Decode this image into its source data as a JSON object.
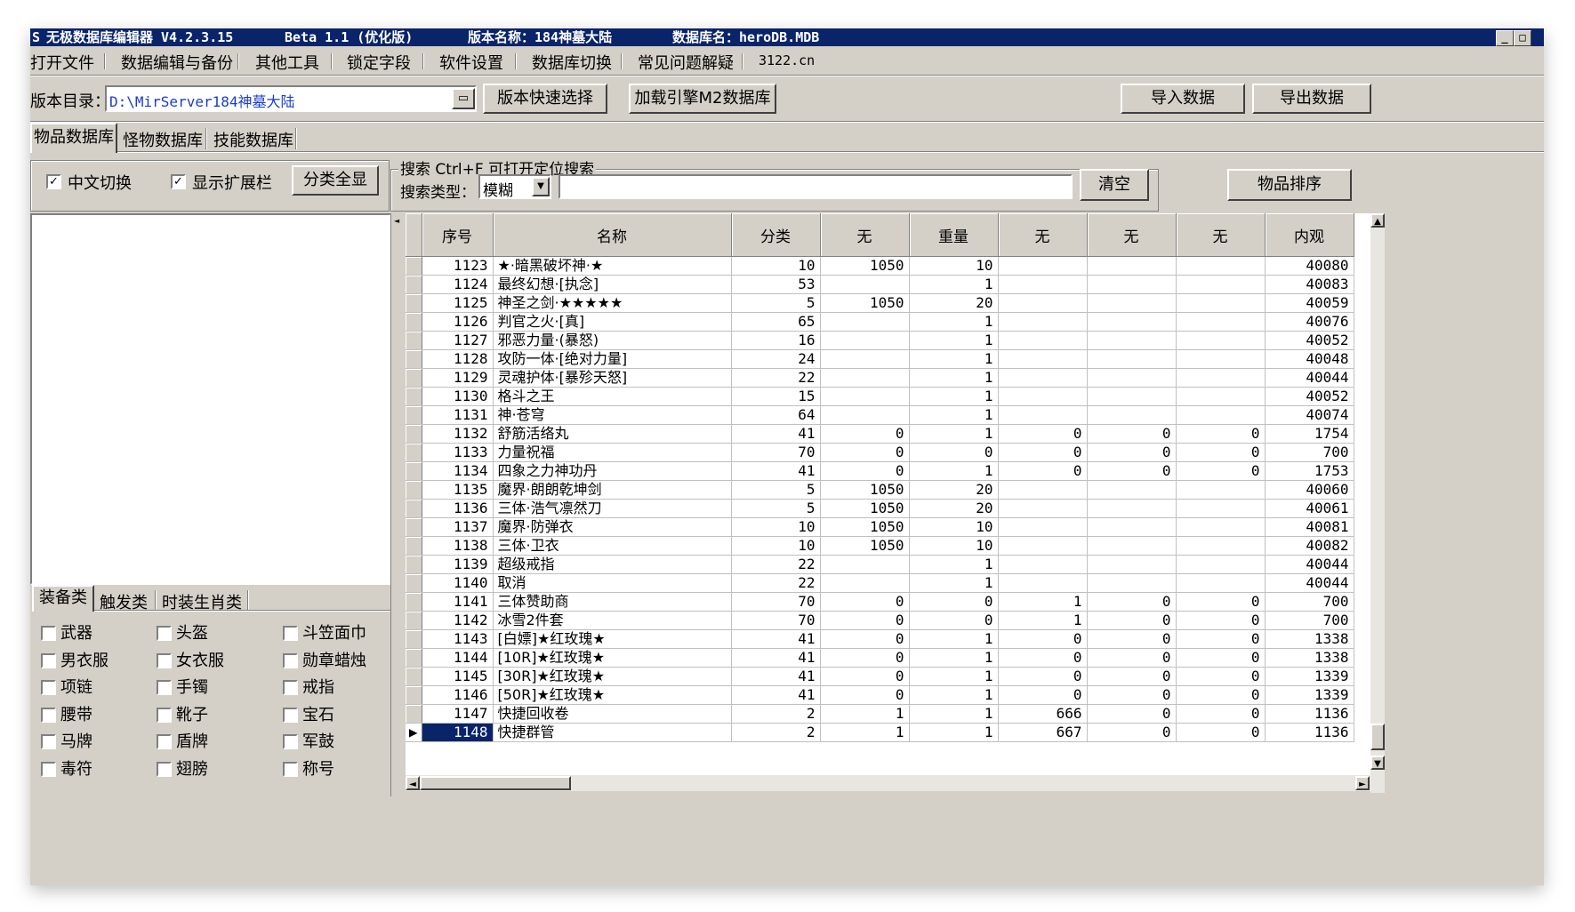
{
  "titlebar": {
    "app_name": "无极数据库编辑器 V4.2.3.15",
    "beta": "Beta 1.1 (优化版)",
    "version_name": "版本名称：184神墓大陆",
    "db_name": "数据库名：heroDB.MDB"
  },
  "menu": [
    "打开文件",
    "数据编辑与备份",
    "其他工具",
    "锁定字段",
    "软件设置",
    "数据库切换",
    "常见问题解疑",
    "3122.cn"
  ],
  "toolbar": {
    "dir_label": "版本目录：",
    "dir_value": "D:\\MirServer184神墓大陆",
    "quick_select": "版本快速选择",
    "load_m2": "加载引擎M2数据库",
    "import": "导入数据",
    "export": "导出数据"
  },
  "tabs": [
    "物品数据库",
    "怪物数据库",
    "技能数据库"
  ],
  "options": {
    "chinese_switch": "中文切换",
    "show_ext": "显示扩展栏",
    "show_all": "分类全显"
  },
  "search": {
    "group_label": "搜索 Ctrl+F 可打开定位搜索",
    "type_label": "搜索类型：",
    "type_value": "模糊",
    "clear": "清空",
    "sort": "物品排序"
  },
  "category_tabs": [
    "装备类",
    "触发类",
    "时装生肖类"
  ],
  "categories": [
    [
      "武器",
      "头盔",
      "斗笠面巾"
    ],
    [
      "男衣服",
      "女衣服",
      "勋章蜡烛"
    ],
    [
      "项链",
      "手镯",
      "戒指"
    ],
    [
      "腰带",
      "靴子",
      "宝石"
    ],
    [
      "马牌",
      "盾牌",
      "军鼓"
    ],
    [
      "毒符",
      "翅膀",
      "称号"
    ]
  ],
  "grid": {
    "headers": [
      "序号",
      "名称",
      "分类",
      "无",
      "重量",
      "无",
      "无",
      "无",
      "内观"
    ],
    "rows": [
      [
        "1123",
        "★·暗黑破坏神·★",
        "10",
        "1050",
        "10",
        "",
        "",
        "",
        "40080"
      ],
      [
        "1124",
        "最终幻想·[执念]",
        "53",
        "",
        "1",
        "",
        "",
        "",
        "40083"
      ],
      [
        "1125",
        "神圣之剑·★★★★★",
        "5",
        "1050",
        "20",
        "",
        "",
        "",
        "40059"
      ],
      [
        "1126",
        "判官之火·[真]",
        "65",
        "",
        "1",
        "",
        "",
        "",
        "40076"
      ],
      [
        "1127",
        "邪恶力量·(暴怒)",
        "16",
        "",
        "1",
        "",
        "",
        "",
        "40052"
      ],
      [
        "1128",
        "攻防一体·[绝对力量]",
        "24",
        "",
        "1",
        "",
        "",
        "",
        "40048"
      ],
      [
        "1129",
        "灵魂护体·[暴殄天怒]",
        "22",
        "",
        "1",
        "",
        "",
        "",
        "40044"
      ],
      [
        "1130",
        "格斗之王",
        "15",
        "",
        "1",
        "",
        "",
        "",
        "40052"
      ],
      [
        "1131",
        "神·苍穹",
        "64",
        "",
        "1",
        "",
        "",
        "",
        "40074"
      ],
      [
        "1132",
        "舒筋活络丸",
        "41",
        "0",
        "1",
        "0",
        "0",
        "0",
        "1754"
      ],
      [
        "1133",
        "力量祝福",
        "70",
        "0",
        "0",
        "0",
        "0",
        "0",
        "700"
      ],
      [
        "1134",
        "四象之力神功丹",
        "41",
        "0",
        "1",
        "0",
        "0",
        "0",
        "1753"
      ],
      [
        "1135",
        "魔界·朗朗乾坤剑",
        "5",
        "1050",
        "20",
        "",
        "",
        "",
        "40060"
      ],
      [
        "1136",
        "三体·浩气凛然刀",
        "5",
        "1050",
        "20",
        "",
        "",
        "",
        "40061"
      ],
      [
        "1137",
        "魔界·防弹衣",
        "10",
        "1050",
        "10",
        "",
        "",
        "",
        "40081"
      ],
      [
        "1138",
        "三体·卫衣",
        "10",
        "1050",
        "10",
        "",
        "",
        "",
        "40082"
      ],
      [
        "1139",
        "超级戒指",
        "22",
        "",
        "1",
        "",
        "",
        "",
        "40044"
      ],
      [
        "1140",
        "取消",
        "22",
        "",
        "1",
        "",
        "",
        "",
        "40044"
      ],
      [
        "1141",
        "三体赞助商",
        "70",
        "0",
        "0",
        "1",
        "0",
        "0",
        "700"
      ],
      [
        "1142",
        "冰雪2件套",
        "70",
        "0",
        "0",
        "1",
        "0",
        "0",
        "700"
      ],
      [
        "1143",
        "[白嫖]★红玫瑰★",
        "41",
        "0",
        "1",
        "0",
        "0",
        "0",
        "1338"
      ],
      [
        "1144",
        "[10R]★红玫瑰★",
        "41",
        "0",
        "1",
        "0",
        "0",
        "0",
        "1338"
      ],
      [
        "1145",
        "[30R]★红玫瑰★",
        "41",
        "0",
        "1",
        "0",
        "0",
        "0",
        "1339"
      ],
      [
        "1146",
        "[50R]★红玫瑰★",
        "41",
        "0",
        "1",
        "0",
        "0",
        "0",
        "1339"
      ],
      [
        "1147",
        "快捷回收卷",
        "2",
        "1",
        "1",
        "666",
        "0",
        "0",
        "1136"
      ],
      [
        "1148",
        "快捷群管",
        "2",
        "1",
        "1",
        "667",
        "0",
        "0",
        "1136"
      ]
    ],
    "selected_index": 25
  }
}
